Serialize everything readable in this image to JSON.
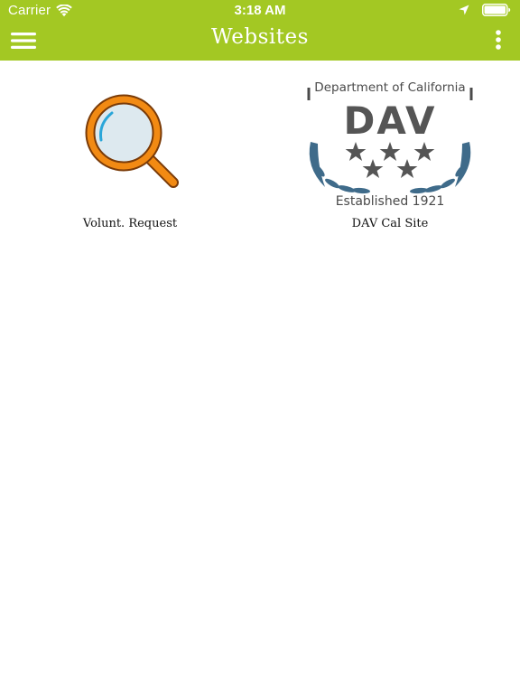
{
  "status_bar": {
    "carrier": "Carrier",
    "time": "3:18 AM",
    "wifi_icon": "wifi-icon",
    "location_icon": "location-arrow-icon",
    "battery_icon": "battery-full-icon"
  },
  "nav": {
    "title": "Websites",
    "menu_icon": "hamburger-menu-icon",
    "more_icon": "vertical-ellipsis-icon",
    "background_color": "#a3c823"
  },
  "websites": [
    {
      "label": "Volunt. Request",
      "icon": "magnifying-glass-icon"
    },
    {
      "label": "DAV Cal Site",
      "icon": "dav-logo",
      "logo_text": {
        "top": "Department of California",
        "mark": "DAV",
        "bottom": "Established 1921"
      }
    }
  ]
}
